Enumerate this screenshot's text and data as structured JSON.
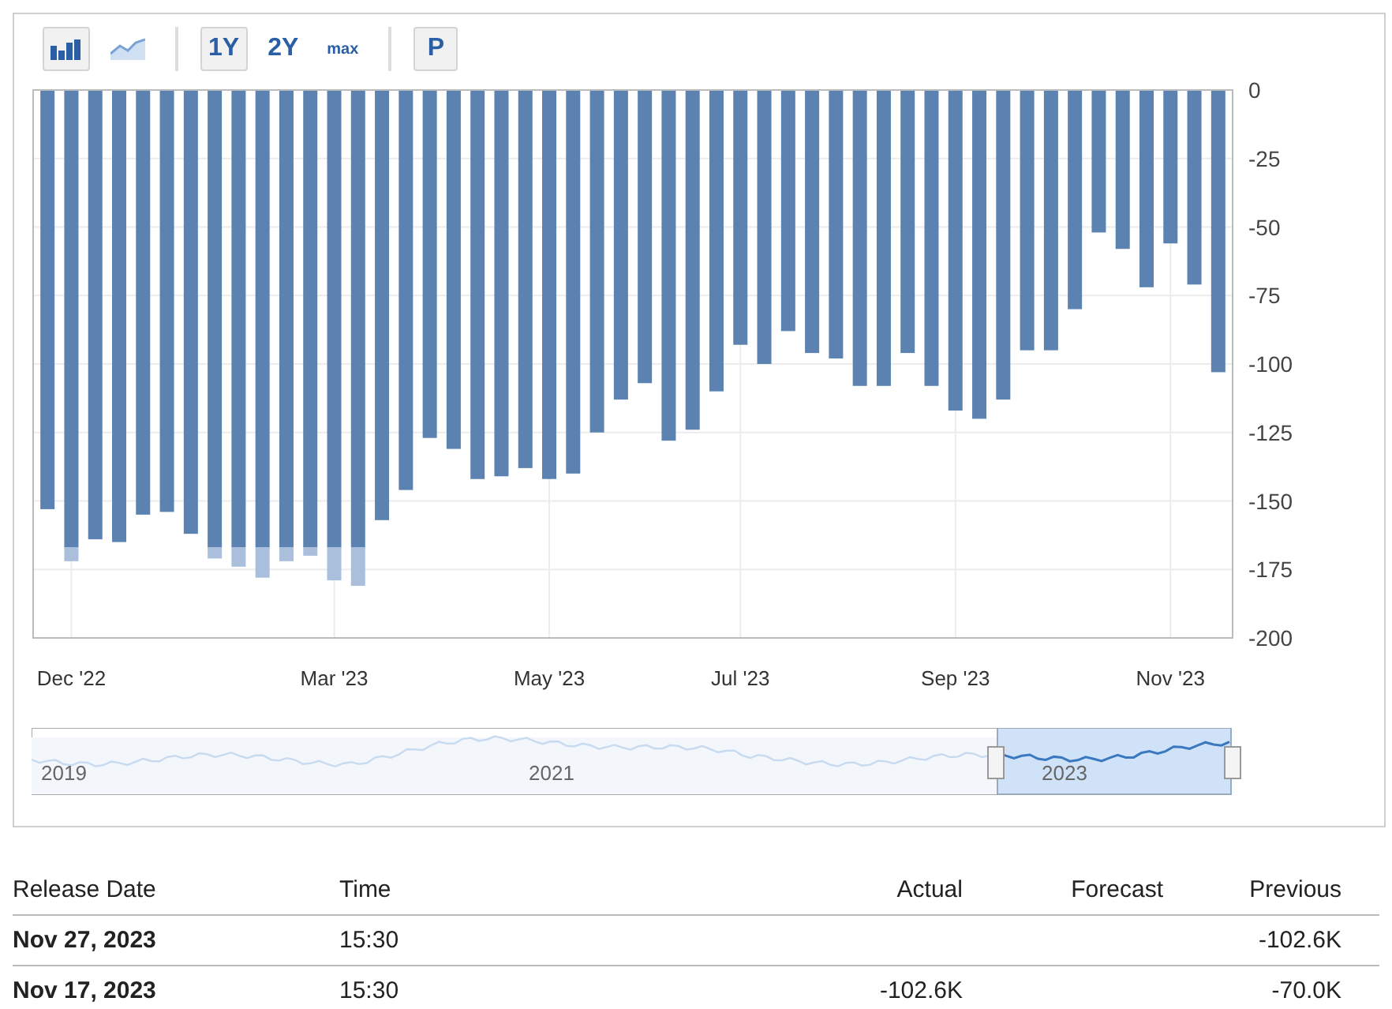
{
  "toolbar": {
    "chart_types": [
      {
        "kind": "bar",
        "selected": true
      },
      {
        "kind": "line",
        "selected": false
      }
    ],
    "ranges": [
      {
        "label": "1Y",
        "selected": true
      },
      {
        "label": "2Y",
        "selected": false
      },
      {
        "label": "max",
        "selected": false
      }
    ],
    "extra": {
      "label": "P",
      "selected": true
    }
  },
  "chart": {
    "chart_data": {
      "type": "bar",
      "categories": [
        null,
        "Dec '22",
        null,
        null,
        null,
        null,
        null,
        null,
        null,
        null,
        null,
        null,
        "Mar '23",
        null,
        null,
        null,
        null,
        null,
        null,
        null,
        null,
        "May '23",
        null,
        null,
        null,
        null,
        null,
        null,
        null,
        "Jul '23",
        null,
        null,
        null,
        null,
        null,
        null,
        null,
        null,
        "Sep '23",
        null,
        null,
        null,
        null,
        null,
        null,
        null,
        null,
        "Nov '23",
        null,
        null
      ],
      "series": [
        {
          "color": "#5b82b0",
          "values": [
            -153,
            -167,
            -164,
            -165,
            -155,
            -154,
            -162,
            -167,
            -167,
            -167,
            -167,
            -167,
            -167,
            -167,
            -157,
            -146,
            -127,
            -131,
            -142,
            -141,
            -138,
            -142,
            -140,
            -125,
            -113,
            -107,
            -128,
            -124,
            -110,
            -93,
            -100,
            -88,
            -96,
            -98,
            -108,
            -108,
            -96,
            -108,
            -117,
            -120,
            -113,
            -95,
            -95,
            -80,
            -52,
            -58,
            -72,
            -56,
            -71,
            -103
          ]
        },
        {
          "color": "#a9bfdc",
          "values": [
            null,
            -5,
            null,
            null,
            null,
            null,
            null,
            -4,
            -7,
            -11,
            -5,
            -3,
            -12,
            -14,
            null,
            null,
            null,
            null,
            null,
            null,
            null,
            null,
            null,
            null,
            null,
            null,
            null,
            null,
            null,
            null,
            null,
            null,
            null,
            null,
            null,
            null,
            null,
            null,
            null,
            null,
            null,
            null,
            null,
            null,
            null,
            null,
            null,
            null,
            null,
            null
          ]
        }
      ],
      "ylim": [
        -200,
        0
      ],
      "grid": true,
      "stacked": true,
      "yticks": [
        0,
        -25,
        -50,
        -75,
        -100,
        -125,
        -150,
        -175,
        -200
      ]
    }
  },
  "navigator": {
    "labels": [
      "2019",
      "2021",
      "2023"
    ]
  },
  "table": {
    "columns": [
      "Release Date",
      "Time",
      "Actual",
      "Forecast",
      "Previous"
    ],
    "rows": [
      [
        "Nov 27, 2023",
        "15:30",
        "",
        "",
        "-102.6K"
      ],
      [
        "Nov 17, 2023",
        "15:30",
        "-102.6K",
        "",
        "-70.0K"
      ]
    ]
  }
}
